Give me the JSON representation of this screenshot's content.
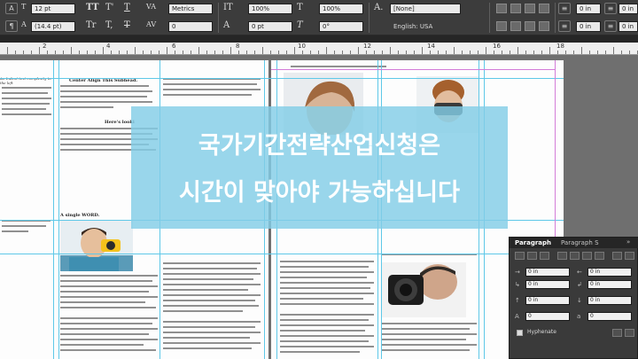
{
  "control_bar": {
    "font_size": "12 pt",
    "leading": "(14.4 pt)",
    "kerning": "Metrics",
    "vertical_scale": "100%",
    "horizontal_scale": "100%",
    "baseline_shift": "0 pt",
    "skew": "0°",
    "tracking": "0",
    "character_style": "[None]",
    "language": "English: USA",
    "fields_right": [
      "0 in",
      "0 in",
      "0 in",
      "0 in"
    ]
  },
  "ruler": {
    "labels": [
      "2",
      "4",
      "6",
      "8",
      "10",
      "12",
      "14",
      "16",
      "18"
    ]
  },
  "document": {
    "left_heading_1": "Center Align This Subhead.",
    "left_heading_2": "Here's looki",
    "left_heading_3": "A single WORD.",
    "left_col1_snip": "An Indent text complexity to the left",
    "right_caption": "Center Align This Subhead."
  },
  "overlay": {
    "line1": "국가기간전략산업신청은",
    "line2": "시간이 맞아야 가능하십니다"
  },
  "paragraph_panel": {
    "tabs": [
      "Paragraph",
      "Paragraph S"
    ],
    "fields": [
      "0 in",
      "0 in",
      "0 in",
      "0 in",
      "0 in",
      "0 in",
      "0",
      "0"
    ],
    "hyphenate_label": "Hyphenate"
  }
}
